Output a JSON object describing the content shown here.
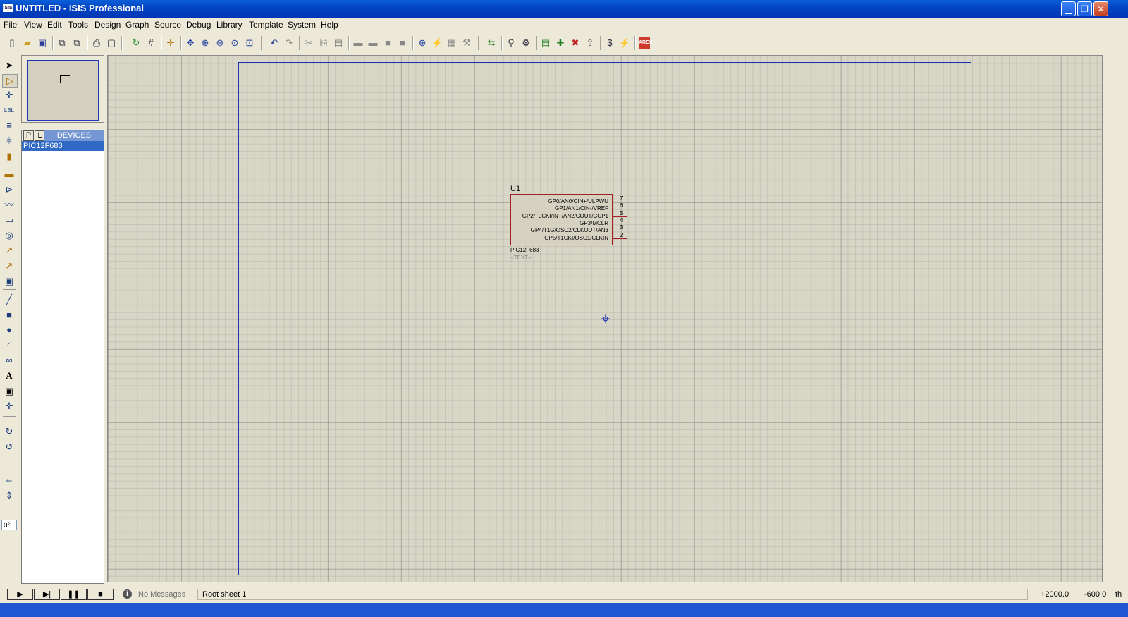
{
  "window": {
    "app_icon": "ISIS",
    "title": "UNTITLED - ISIS Professional",
    "minimize_icon": "minimize-icon",
    "maximize_icon": "restore-icon",
    "close_icon": "close-icon"
  },
  "menu": [
    "File",
    "View",
    "Edit",
    "Tools",
    "Design",
    "Graph",
    "Source",
    "Debug",
    "Library",
    "Template",
    "System",
    "Help"
  ],
  "toolbar_icons": [
    "new-icon",
    "open-icon",
    "save-icon",
    "import-icon",
    "export-icon",
    "print-icon",
    "print-area-icon",
    "refresh-icon",
    "grid-icon",
    "origin-icon",
    "pan-icon",
    "zoom-in-icon",
    "zoom-out-icon",
    "zoom-all-icon",
    "zoom-area-icon",
    "undo-icon",
    "redo-icon",
    "cut-icon",
    "copy-icon",
    "paste-icon",
    "block-copy-icon",
    "block-move-icon",
    "block-rotate-icon",
    "block-delete-icon",
    "pick-device-icon",
    "make-device-icon",
    "packaging-icon",
    "decompose-icon",
    "wire-autorouter-icon",
    "search-tag-icon",
    "property-assign-icon",
    "new-sheet-icon",
    "add-sheet-icon",
    "remove-sheet-icon",
    "exit-parent-icon",
    "bom-icon",
    "erc-icon",
    "ares-icon"
  ],
  "left_tools": [
    "selection-mode-icon",
    "component-mode-icon",
    "junction-icon",
    "wire-label-icon",
    "text-script-icon",
    "bus-icon",
    "subcircuit-icon",
    "terminals-icon",
    "device-pins-icon",
    "graph-icon",
    "tape-recorder-icon",
    "generator-icon",
    "voltage-probe-icon",
    "current-probe-icon",
    "virtual-instruments-icon",
    "line-icon",
    "box-icon",
    "circle-icon",
    "arc-icon",
    "path-icon",
    "text-icon",
    "symbol-icon",
    "marker-icon",
    "rotate-cw-icon",
    "rotate-ccw-icon",
    "mirror-x-icon",
    "mirror-y-icon"
  ],
  "rotation_value": "0°",
  "devices": {
    "tab_p": "P",
    "tab_l": "L",
    "title": "DEVICES",
    "items": [
      "PIC12F683"
    ]
  },
  "component": {
    "ref": "U1",
    "name": "PIC12F683",
    "text": "<TEXT>",
    "pins": [
      {
        "label": "GP0/AN0/CIN+/ULPWU",
        "num": "7"
      },
      {
        "label": "GP1/AN1/CIN-/VREF",
        "num": "6"
      },
      {
        "label": "GP2/T0CKI/INT/AN2/COUT/CCP1",
        "num": "5"
      },
      {
        "label": "GP3/MCLR",
        "num": "4"
      },
      {
        "label": "GP4/T1G/OSC2/CLKOUT/AN3",
        "num": "3"
      },
      {
        "label": "GP5/T1CKI/OSC1/CLKIN",
        "num": "2"
      }
    ]
  },
  "status": {
    "messages": "No Messages",
    "sheet": "Root sheet 1",
    "x": "+2000.0",
    "y": "-600.0",
    "unit": "th"
  },
  "colors": {
    "sheet_border": "#1d2fb5",
    "component_border": "#a32020",
    "selected": "#316ac5"
  }
}
